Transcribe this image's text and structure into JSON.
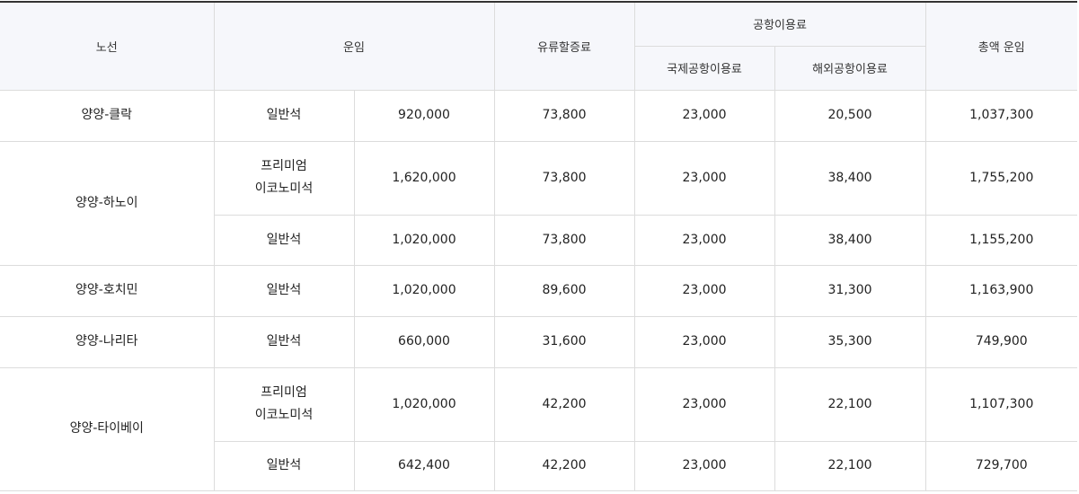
{
  "headers": {
    "route": "노선",
    "fare": "운임",
    "fuel": "유류할증료",
    "airport_fee": "공항이용료",
    "intl_airport_fee": "국제공항이용료",
    "foreign_airport_fee": "해외공항이용료",
    "total": "총액 운임"
  },
  "routes": [
    {
      "name": "양양-클락",
      "classes": [
        {
          "class_lines": [
            "일반석"
          ],
          "fare": "920,000",
          "fuel": "73,800",
          "intl": "23,000",
          "foreign": "20,500",
          "total": "1,037,300"
        }
      ]
    },
    {
      "name": "양양-하노이",
      "classes": [
        {
          "class_lines": [
            "프리미엄",
            "이코노미석"
          ],
          "fare": "1,620,000",
          "fuel": "73,800",
          "intl": "23,000",
          "foreign": "38,400",
          "total": "1,755,200"
        },
        {
          "class_lines": [
            "일반석"
          ],
          "fare": "1,020,000",
          "fuel": "73,800",
          "intl": "23,000",
          "foreign": "38,400",
          "total": "1,155,200"
        }
      ]
    },
    {
      "name": "양양-호치민",
      "classes": [
        {
          "class_lines": [
            "일반석"
          ],
          "fare": "1,020,000",
          "fuel": "89,600",
          "intl": "23,000",
          "foreign": "31,300",
          "total": "1,163,900"
        }
      ]
    },
    {
      "name": "양양-나리타",
      "classes": [
        {
          "class_lines": [
            "일반석"
          ],
          "fare": "660,000",
          "fuel": "31,600",
          "intl": "23,000",
          "foreign": "35,300",
          "total": "749,900"
        }
      ]
    },
    {
      "name": "양양-타이베이",
      "classes": [
        {
          "class_lines": [
            "프리미엄",
            "이코노미석"
          ],
          "fare": "1,020,000",
          "fuel": "42,200",
          "intl": "23,000",
          "foreign": "22,100",
          "total": "1,107,300"
        },
        {
          "class_lines": [
            "일반석"
          ],
          "fare": "642,400",
          "fuel": "42,200",
          "intl": "23,000",
          "foreign": "22,100",
          "total": "729,700"
        }
      ]
    }
  ]
}
